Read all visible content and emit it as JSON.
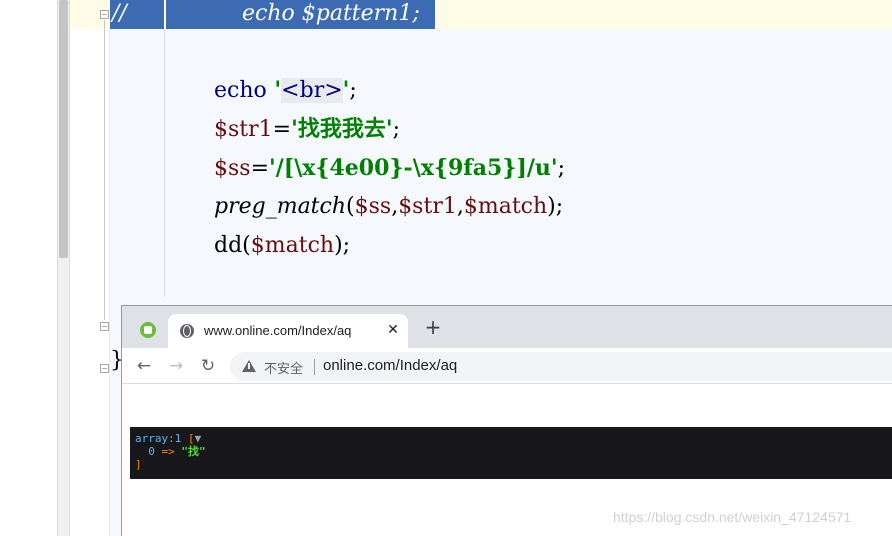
{
  "editor": {
    "selected_line": {
      "comment": "//",
      "code": "echo $pattern1;"
    },
    "lines": [
      {
        "tokens": [
          {
            "t": "echo",
            "c": "kw"
          },
          {
            "t": " '",
            "c": "str"
          },
          {
            "t": "<br>",
            "c": "brhl"
          },
          {
            "t": "'",
            "c": "str"
          },
          {
            "t": ";",
            "c": "plain"
          }
        ]
      },
      {
        "tokens": [
          {
            "t": "$str1",
            "c": "var"
          },
          {
            "t": "=",
            "c": "plain"
          },
          {
            "t": "'找我我去'",
            "c": "str"
          },
          {
            "t": ";",
            "c": "plain"
          }
        ]
      },
      {
        "tokens": [
          {
            "t": "$ss",
            "c": "var"
          },
          {
            "t": "=",
            "c": "plain"
          },
          {
            "t": "'/[\\x{4e00}-\\x{9fa5}]/u'",
            "c": "str"
          },
          {
            "t": ";",
            "c": "plain"
          }
        ]
      },
      {
        "tokens": [
          {
            "t": "preg_match",
            "c": "fn"
          },
          {
            "t": "(",
            "c": "plain"
          },
          {
            "t": "$ss",
            "c": "var"
          },
          {
            "t": ",",
            "c": "plain"
          },
          {
            "t": "$str1",
            "c": "var"
          },
          {
            "t": ",",
            "c": "plain"
          },
          {
            "t": "$match",
            "c": "var"
          },
          {
            "t": ");",
            "c": "plain"
          }
        ]
      },
      {
        "tokens": [
          {
            "t": "dd",
            "c": "plain"
          },
          {
            "t": "(",
            "c": "plain"
          },
          {
            "t": "$match",
            "c": "var"
          },
          {
            "t": ");",
            "c": "plain"
          }
        ]
      }
    ],
    "closing_brace": "}"
  },
  "browser": {
    "app_icon": "app-logo-icon",
    "tab": {
      "icon": "globe-icon",
      "title": "www.online.com/Index/aq",
      "close": "✕"
    },
    "new_tab": "+",
    "nav": {
      "back": "←",
      "forward": "→",
      "reload": "↻"
    },
    "omnibox": {
      "security_icon": "warning-icon",
      "security_text": "不安全",
      "url": "online.com/Index/aq"
    },
    "dump": {
      "header": "array:1",
      "open_bracket": "[",
      "toggle": "▼",
      "key": "0",
      "arrow": " => ",
      "value": "\"找\"",
      "close_bracket": "]"
    }
  },
  "watermark": "https://blog.csdn.net/weixin_47124571",
  "colors": {
    "keyword": "#000080",
    "string": "#008000",
    "variable": "#660e0e",
    "selection": "#3c6bb3",
    "dump_bg": "#18171b"
  }
}
